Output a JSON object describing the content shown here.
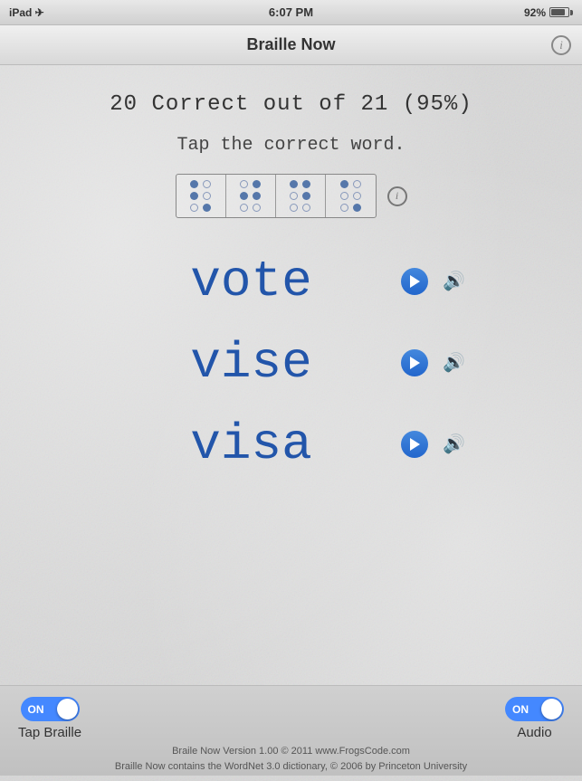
{
  "statusBar": {
    "left": "iPad ✈",
    "time": "6:07 PM",
    "battery": "92%"
  },
  "titleBar": {
    "title": "Braille Now",
    "infoIcon": "ℹ"
  },
  "score": {
    "text": "20 Correct out of 21 (95%)"
  },
  "instruction": {
    "text": "Tap the correct word."
  },
  "braille": {
    "infoIcon": "ℹ",
    "cells": [
      {
        "rows": [
          [
            true,
            false
          ],
          [
            true,
            false
          ],
          [
            false,
            false
          ]
        ]
      },
      {
        "rows": [
          [
            false,
            false
          ],
          [
            true,
            false
          ],
          [
            true,
            false
          ]
        ]
      },
      {
        "rows": [
          [
            true,
            true
          ],
          [
            false,
            true
          ],
          [
            false,
            false
          ]
        ]
      },
      {
        "rows": [
          [
            true,
            false
          ],
          [
            false,
            false
          ],
          [
            false,
            true
          ]
        ]
      }
    ]
  },
  "answers": [
    {
      "word": "vote",
      "playLabel": "play",
      "soundLabel": "speaker"
    },
    {
      "word": "vise",
      "playLabel": "play",
      "soundLabel": "speaker"
    },
    {
      "word": "visa",
      "playLabel": "play",
      "soundLabel": "speaker"
    }
  ],
  "bottomControls": {
    "tapBrailleToggle": "ON",
    "tapBrailleLabel": "Tap Braille",
    "audioToggle": "ON",
    "audioLabel": "Audio"
  },
  "footer": {
    "line1": "Braile Now Version 1.00 © 2011 www.FrogsCode.com",
    "line2": "Braille Now contains the WordNet 3.0 dictionary, © 2006 by Princeton University"
  }
}
